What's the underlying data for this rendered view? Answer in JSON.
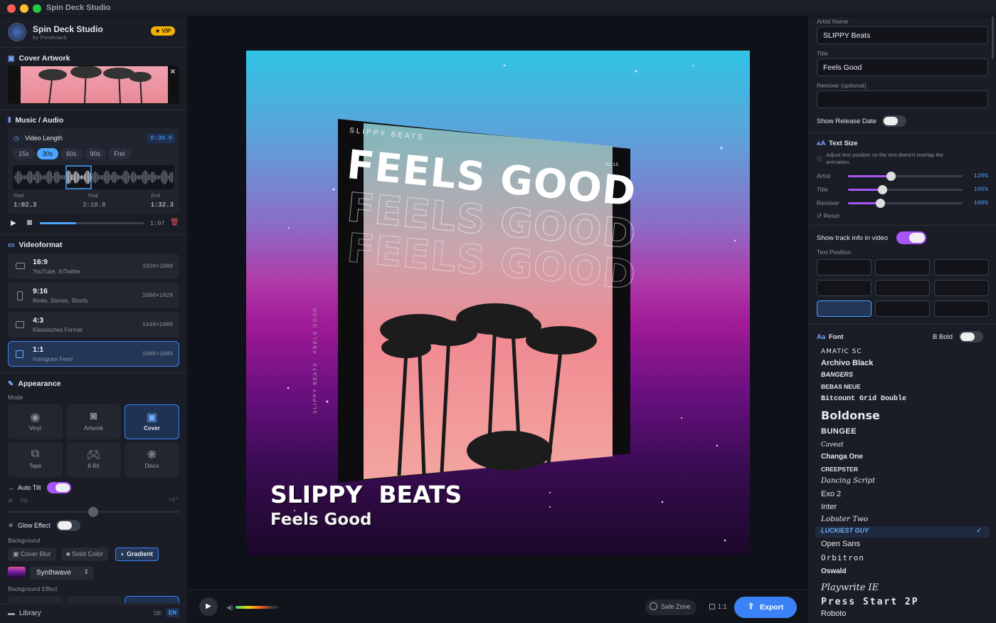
{
  "window": {
    "title": "Spin Deck Studio"
  },
  "brand": {
    "name": "Spin Deck Studio",
    "sub": "by Pondstack",
    "badge": "★ VIP"
  },
  "left": {
    "cover_title": "Cover Artwork",
    "music_title": "Music / Audio",
    "video_length": {
      "label": "Video Length",
      "value": "0:30.0",
      "options": [
        "15s",
        "30s",
        "60s",
        "90s",
        "Frei"
      ],
      "selected": "30s"
    },
    "times": {
      "start_label": "Start",
      "start": "1:02.3",
      "total_label": "Total",
      "total": "3:10.8",
      "end_label": "End",
      "end": "1:32.3"
    },
    "player": {
      "time": "1:07",
      "progress": 0.35
    },
    "videoformat_title": "Videoformat",
    "formats": [
      {
        "title": "16:9",
        "sub": "YouTube, X/Twitter",
        "res": "1920×1080"
      },
      {
        "title": "9:16",
        "sub": "Reels, Stories, Shorts",
        "res": "1080×1920"
      },
      {
        "title": "4:3",
        "sub": "Klassisches Format",
        "res": "1440×1080"
      },
      {
        "title": "1:1",
        "sub": "Instagram Feed",
        "res": "1080×1080"
      }
    ],
    "appearance_title": "Appearance",
    "mode_label": "Mode",
    "modes": [
      "Vinyl",
      "Artwork",
      "Cover",
      "Tape",
      "8-Bit",
      "Disco"
    ],
    "auto_tilt": "Auto Tilt",
    "tilt": "Tilt",
    "tilt_value": "+0°",
    "glow": "Glow Effect",
    "background_label": "Background",
    "bg_options": [
      "Cover Blur",
      "Solid Color",
      "Gradient"
    ],
    "gradient_name": "Synthwave",
    "bg_effect_label": "Background Effect",
    "library": "Library",
    "lang": [
      "DE",
      "EN"
    ]
  },
  "preview": {
    "cover_small": "SLIPPY BEATS",
    "cover_big": "FEELS GOOD",
    "cover_time": "02:15",
    "spine": "SLIPPY BEATS · FEELS GOOD",
    "artist": "SLIPPY  BEATS",
    "title": "Feels Good"
  },
  "bottom": {
    "safe_zone": "Safe Zone",
    "ratio": "1:1",
    "export": "Export"
  },
  "right": {
    "artist_label": "Artist Name",
    "artist_value": "SLIPPY  Beats",
    "title_label": "Title",
    "title_value": "Feels Good",
    "remixer_label": "Remixer (optional)",
    "release_date": "Show Release Date",
    "text_size_title": "Text Size",
    "text_size_hint": "Adjust text position so the text doesn't overlap the animation.",
    "sizes": [
      {
        "label": "Artist",
        "value": "120%",
        "fill": 0.37
      },
      {
        "label": "Title",
        "value": "105%",
        "fill": 0.3
      },
      {
        "label": "Remixer",
        "value": "100%",
        "fill": 0.28
      }
    ],
    "reset": "↺ Reset",
    "track_info": "Show track info in video",
    "text_position": "Text Position",
    "font_title": "Font",
    "bold_label": "B  Bold",
    "fonts": [
      "AMATIC SC",
      "Archivo Black",
      "BANGERS",
      "BEBAS NEUE",
      "Bitcount Grid Double",
      "Boldonse",
      "BUNGEE",
      "Caveat",
      "Changa One",
      "CREEPSTER",
      "Dancing Script",
      "Exo 2",
      "Inter",
      "Lobster Two",
      "LUCKIEST GUY",
      "Open Sans",
      "Orbitron",
      "Oswald",
      "Playwrite IE",
      "Press Start 2P",
      "Roboto"
    ],
    "selected_font": "LUCKIEST GUY"
  },
  "colors": {
    "accent": "#4aa3ff",
    "purple": "#a855f7"
  }
}
